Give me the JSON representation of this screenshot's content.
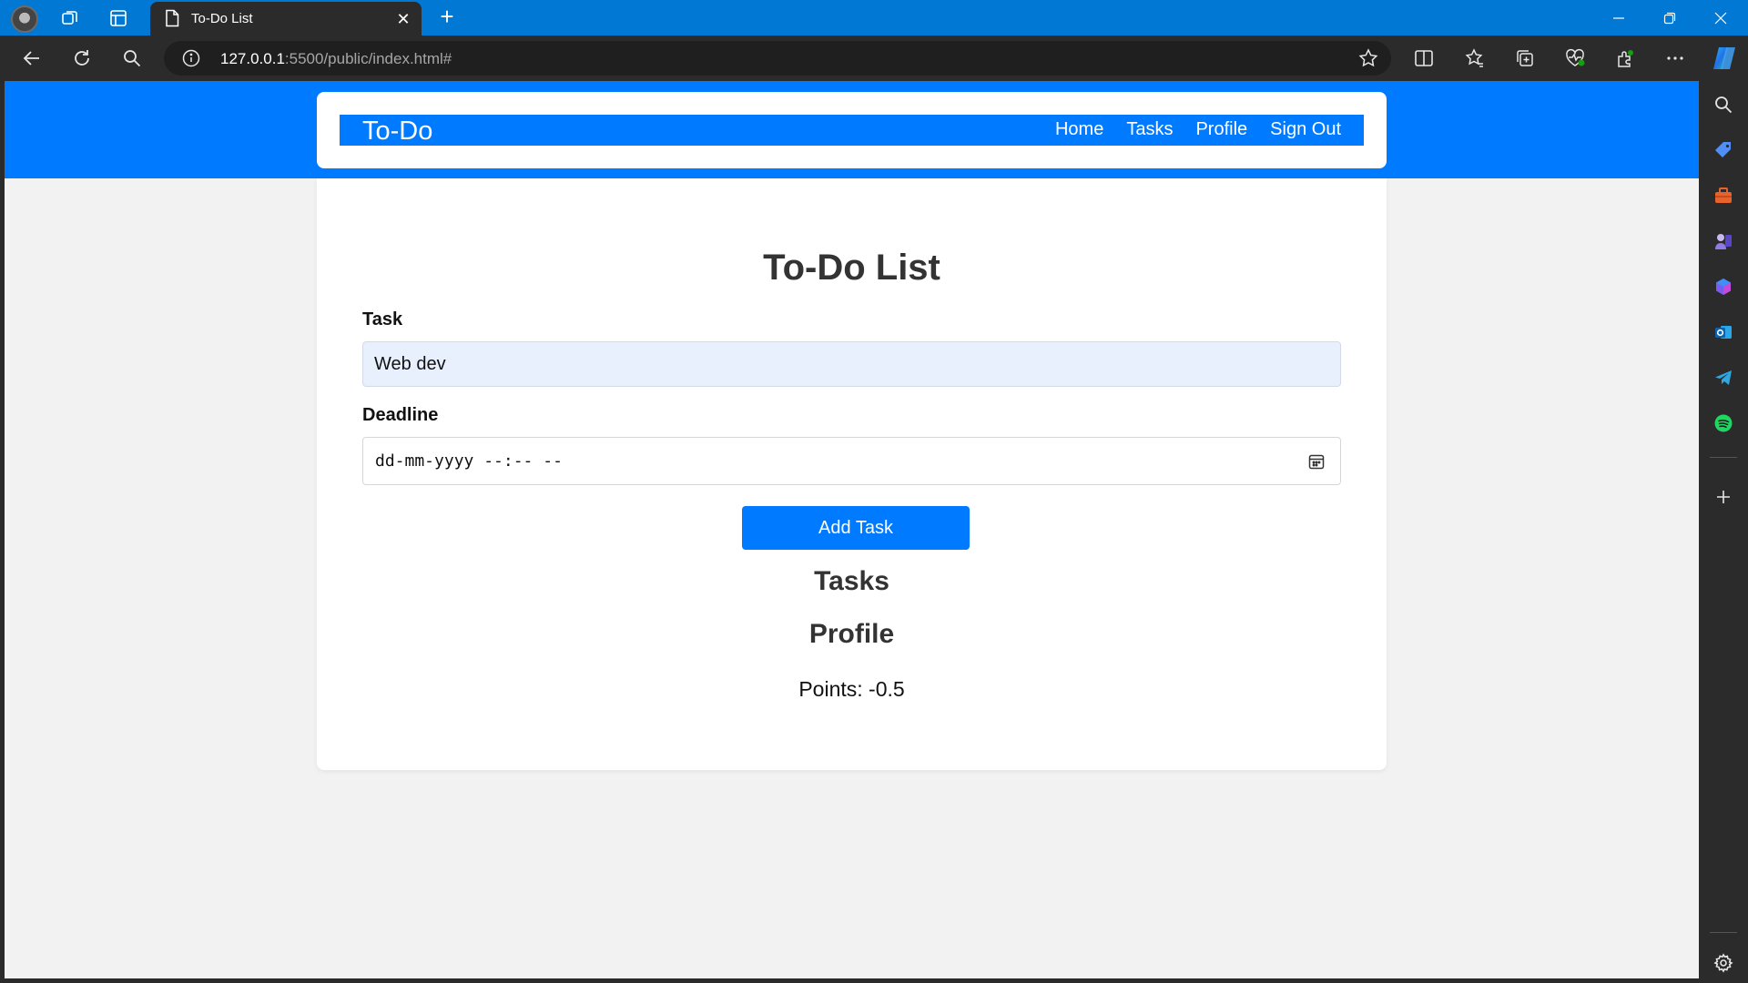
{
  "browser": {
    "tab_title": "To-Do List",
    "url_host": "127.0.0.1",
    "url_rest": ":5500/public/index.html#",
    "accent_color": "#0078d4",
    "toolbar_icons": [
      "back-icon",
      "refresh-icon",
      "search-icon",
      "info-icon",
      "favorite-star-icon",
      "split-screen-icon",
      "favorites-icon",
      "collections-icon",
      "browser-essentials-icon",
      "extensions-icon",
      "more-icon",
      "copilot-icon"
    ],
    "sidebar_icons": [
      "search-icon",
      "shopping-tag-icon",
      "tools-icon",
      "games-icon",
      "microsoft-365-icon",
      "outlook-icon",
      "telegram-icon",
      "spotify-icon",
      "add-icon",
      "settings-icon"
    ]
  },
  "navbar": {
    "brand": "To-Do",
    "links": [
      "Home",
      "Tasks",
      "Profile",
      "Sign Out"
    ],
    "color": "#007bff"
  },
  "main": {
    "title": "To-Do List",
    "task_label": "Task",
    "task_value": "Web dev",
    "deadline_label": "Deadline",
    "deadline_placeholder": "dd-mm-yyyy --:-- --",
    "add_button": "Add Task",
    "tasks_heading": "Tasks",
    "profile_heading": "Profile",
    "points_text": "Points: -0.5"
  }
}
